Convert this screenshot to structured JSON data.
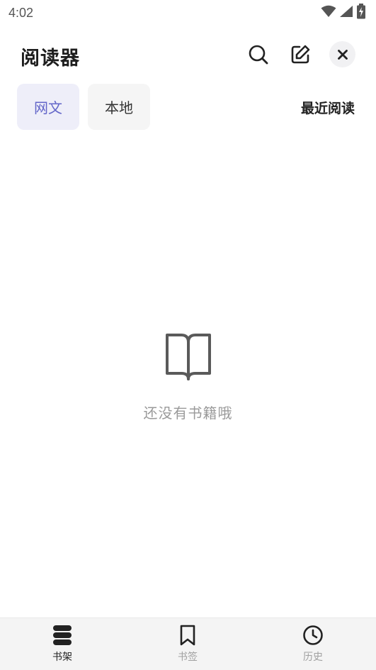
{
  "status_bar": {
    "time": "4:02",
    "icons": [
      "wifi-icon",
      "cell-signal-icon",
      "battery-charging-icon"
    ]
  },
  "header": {
    "title": "阅读器",
    "actions": [
      "search-icon",
      "edit-icon",
      "close-icon"
    ]
  },
  "tabs": {
    "items": [
      {
        "label": "网文",
        "selected": true
      },
      {
        "label": "本地",
        "selected": false
      }
    ],
    "recent_label": "最近阅读"
  },
  "empty_state": {
    "icon": "open-book-icon",
    "text": "还没有书籍哦"
  },
  "bottom_nav": {
    "items": [
      {
        "label": "书架",
        "icon": "bookshelf-icon",
        "active": true
      },
      {
        "label": "书签",
        "icon": "bookmark-icon",
        "active": false
      },
      {
        "label": "历史",
        "icon": "clock-icon",
        "active": false
      }
    ]
  },
  "colors": {
    "accent": "#6366c9",
    "selected_tab_bg": "#eeeef9",
    "tab_bg": "#f5f5f5",
    "muted_text": "#9a9a9a",
    "nav_bg": "#f4f4f4"
  }
}
